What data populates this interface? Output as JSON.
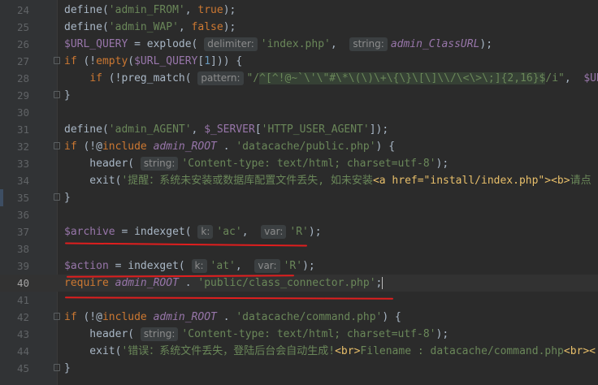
{
  "editor": {
    "lines": [
      {
        "n": "24",
        "tokens": [
          [
            "fn",
            "define("
          ],
          [
            "str",
            "'admin_FROM'"
          ],
          [
            "fn",
            ", "
          ],
          [
            "kw",
            "true"
          ],
          [
            "fn",
            ");"
          ]
        ]
      },
      {
        "n": "25",
        "tokens": [
          [
            "fn",
            "define("
          ],
          [
            "str",
            "'admin_WAP'"
          ],
          [
            "fn",
            ", "
          ],
          [
            "kw",
            "false"
          ],
          [
            "fn",
            ");"
          ]
        ]
      },
      {
        "n": "26",
        "tokens": [
          [
            "var",
            "$URL_QUERY"
          ],
          [
            "fn",
            " = explode( "
          ],
          [
            "hint",
            "delimiter:"
          ],
          [
            "str",
            "'index.php'"
          ],
          [
            "fn",
            ",  "
          ],
          [
            "hint",
            "string:"
          ],
          [
            "const",
            "admin_ClassURL"
          ],
          [
            "fn",
            ");"
          ]
        ]
      },
      {
        "n": "27",
        "fold": true,
        "tokens": [
          [
            "kw",
            "if "
          ],
          [
            "fn",
            "(!"
          ],
          [
            "kw",
            "empty"
          ],
          [
            "fn",
            "("
          ],
          [
            "var",
            "$URL_QUERY"
          ],
          [
            "fn",
            "["
          ],
          [
            "num",
            "1"
          ],
          [
            "fn",
            "])) {"
          ]
        ]
      },
      {
        "n": "28",
        "tokens": [
          [
            "fn",
            "    "
          ],
          [
            "kw",
            "if "
          ],
          [
            "fn",
            "(!preg_match( "
          ],
          [
            "hint",
            "pattern:"
          ],
          [
            "str",
            "\"/"
          ],
          [
            "regex",
            "^[^!@~`\\'\\\"#\\*\\(\\)\\+\\{\\}\\[\\]\\\\/\\<\\>\\;]{2,16}$"
          ],
          [
            "str",
            "/i\""
          ],
          [
            "fn",
            ",  "
          ],
          [
            "var",
            "$URL_"
          ]
        ]
      },
      {
        "n": "29",
        "fold": true,
        "tokens": [
          [
            "fn",
            "}"
          ]
        ]
      },
      {
        "n": "30",
        "tokens": []
      },
      {
        "n": "31",
        "tokens": [
          [
            "fn",
            "define("
          ],
          [
            "str",
            "'admin_AGENT'"
          ],
          [
            "fn",
            ", "
          ],
          [
            "var",
            "$_SERVER"
          ],
          [
            "fn",
            "["
          ],
          [
            "str",
            "'HTTP_USER_AGENT'"
          ],
          [
            "fn",
            "]);"
          ]
        ]
      },
      {
        "n": "32",
        "fold": true,
        "tokens": [
          [
            "kw",
            "if "
          ],
          [
            "fn",
            "(!@"
          ],
          [
            "kw",
            "include "
          ],
          [
            "const",
            "admin_ROOT"
          ],
          [
            "fn",
            " . "
          ],
          [
            "str",
            "'datacache/public.php'"
          ],
          [
            "fn",
            ") {"
          ]
        ]
      },
      {
        "n": "33",
        "tokens": [
          [
            "fn",
            "    header( "
          ],
          [
            "hint",
            "string:"
          ],
          [
            "str",
            "'Content-type: text/html; charset=utf-8'"
          ],
          [
            "fn",
            ");"
          ]
        ]
      },
      {
        "n": "34",
        "tokens": [
          [
            "fn",
            "    exit("
          ],
          [
            "str",
            "'"
          ],
          [
            "chinese",
            "提醒：系统未安装或数据库配置文件丢失, 如未安装"
          ],
          [
            "tag",
            "<a href=\"install/index.php\"><b>"
          ],
          [
            "chinese",
            "请点"
          ]
        ]
      },
      {
        "n": "35",
        "fold": true,
        "bp": true,
        "tokens": [
          [
            "fn",
            "}"
          ]
        ]
      },
      {
        "n": "36",
        "tokens": []
      },
      {
        "n": "37",
        "tokens": [
          [
            "var",
            "$archive"
          ],
          [
            "fn",
            " = indexget( "
          ],
          [
            "hint",
            "k:"
          ],
          [
            "str",
            "'ac'"
          ],
          [
            "fn",
            ",  "
          ],
          [
            "hint",
            "var:"
          ],
          [
            "str",
            "'R'"
          ],
          [
            "fn",
            ");"
          ]
        ]
      },
      {
        "n": "38",
        "tokens": []
      },
      {
        "n": "39",
        "tokens": [
          [
            "var",
            "$action"
          ],
          [
            "fn",
            " = indexget( "
          ],
          [
            "hint",
            "k:"
          ],
          [
            "str",
            "'at'"
          ],
          [
            "fn",
            ",  "
          ],
          [
            "hint",
            "var:"
          ],
          [
            "str",
            "'R'"
          ],
          [
            "fn",
            ");"
          ]
        ]
      },
      {
        "n": "40",
        "current": true,
        "tokens": [
          [
            "kw",
            "require "
          ],
          [
            "const",
            "admin_ROOT"
          ],
          [
            "fn",
            " . "
          ],
          [
            "str",
            "'public/class_connector.php'"
          ],
          [
            "fn",
            ";"
          ],
          [
            "caret",
            ""
          ]
        ]
      },
      {
        "n": "41",
        "tokens": []
      },
      {
        "n": "42",
        "fold": true,
        "tokens": [
          [
            "kw",
            "if "
          ],
          [
            "fn",
            "(!@"
          ],
          [
            "kw",
            "include "
          ],
          [
            "const",
            "admin_ROOT"
          ],
          [
            "fn",
            " . "
          ],
          [
            "str",
            "'datacache/command.php'"
          ],
          [
            "fn",
            ") {"
          ]
        ]
      },
      {
        "n": "43",
        "tokens": [
          [
            "fn",
            "    header( "
          ],
          [
            "hint",
            "string:"
          ],
          [
            "str",
            "'Content-type: text/html; charset=utf-8'"
          ],
          [
            "fn",
            ");"
          ]
        ]
      },
      {
        "n": "44",
        "tokens": [
          [
            "fn",
            "    exit("
          ],
          [
            "str",
            "'"
          ],
          [
            "chinese",
            "错误：系统文件丢失，登陆后台会自动生成!"
          ],
          [
            "tag",
            "<br>"
          ],
          [
            "str",
            "Filename : datacache/command.php"
          ],
          [
            "tag",
            "<br><"
          ]
        ]
      },
      {
        "n": "45",
        "fold": true,
        "tokens": [
          [
            "fn",
            "}"
          ]
        ]
      }
    ]
  },
  "annotations": {
    "color": "#e01e1e"
  }
}
